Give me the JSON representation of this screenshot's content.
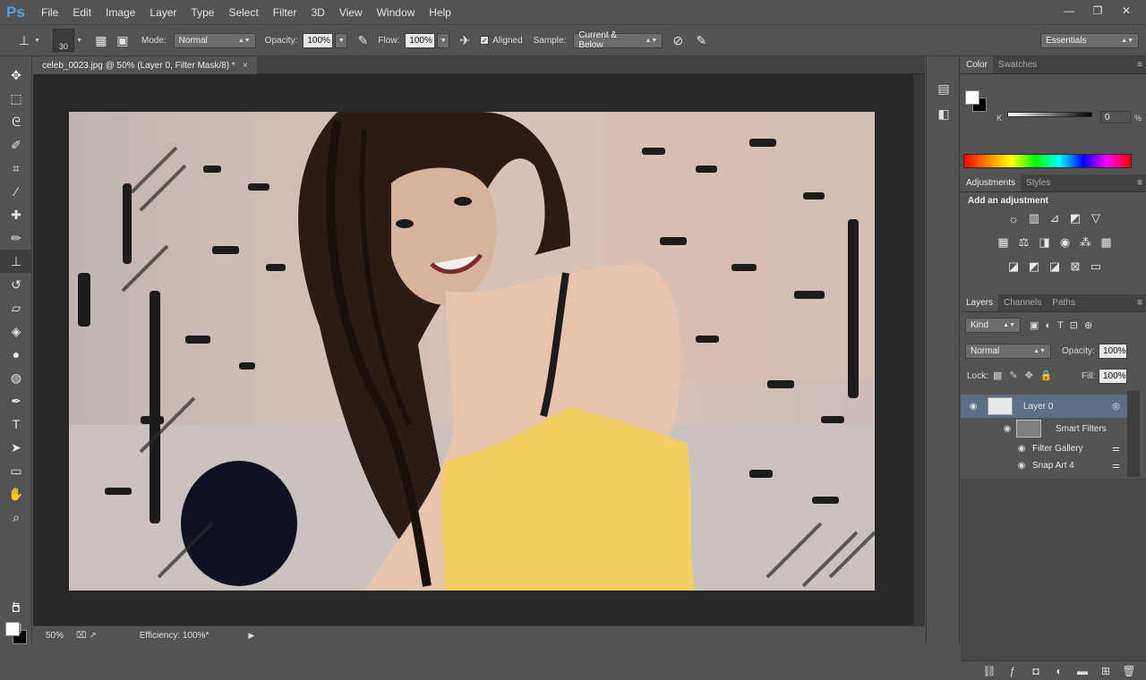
{
  "app": {
    "logo": "Ps"
  },
  "menu": [
    "File",
    "Edit",
    "Image",
    "Layer",
    "Type",
    "Select",
    "Filter",
    "3D",
    "View",
    "Window",
    "Help"
  ],
  "window_controls": [
    "—",
    "❐",
    "✕"
  ],
  "options": {
    "brush_size": "30",
    "mode_label": "Mode:",
    "mode_value": "Normal",
    "opacity_label": "Opacity:",
    "opacity_value": "100%",
    "flow_label": "Flow:",
    "flow_value": "100%",
    "aligned_label": "Aligned",
    "sample_label": "Sample:",
    "sample_value": "Current & Below",
    "workspace": "Essentials"
  },
  "document": {
    "tab_title": "celeb_0023.jpg @ 50% (Layer 0, Filter Mask/8) *",
    "tab_close": "×"
  },
  "status": {
    "zoom": "50%",
    "info": "Efficiency: 100%*"
  },
  "color_panel": {
    "tabs": [
      "Color",
      "Swatches"
    ],
    "channel": "K",
    "value": "0"
  },
  "adjustments": {
    "tabs": [
      "Adjustments",
      "Styles"
    ],
    "title": "Add an adjustment"
  },
  "layers": {
    "tabs": [
      "Layers",
      "Channels",
      "Paths"
    ],
    "kind": "Kind",
    "blend": "Normal",
    "opacity_label": "Opacity:",
    "opacity_value": "100%",
    "lock_label": "Lock:",
    "fill_label": "Fill:",
    "fill_value": "100%",
    "items": [
      {
        "name": "Layer 0"
      },
      {
        "name": "Smart Filters"
      },
      {
        "name": "Filter Gallery"
      },
      {
        "name": "Snap Art 4"
      }
    ]
  },
  "colors": {
    "accent_selected": "#5b6f87",
    "panel": "#535353",
    "dark": "#282828"
  }
}
